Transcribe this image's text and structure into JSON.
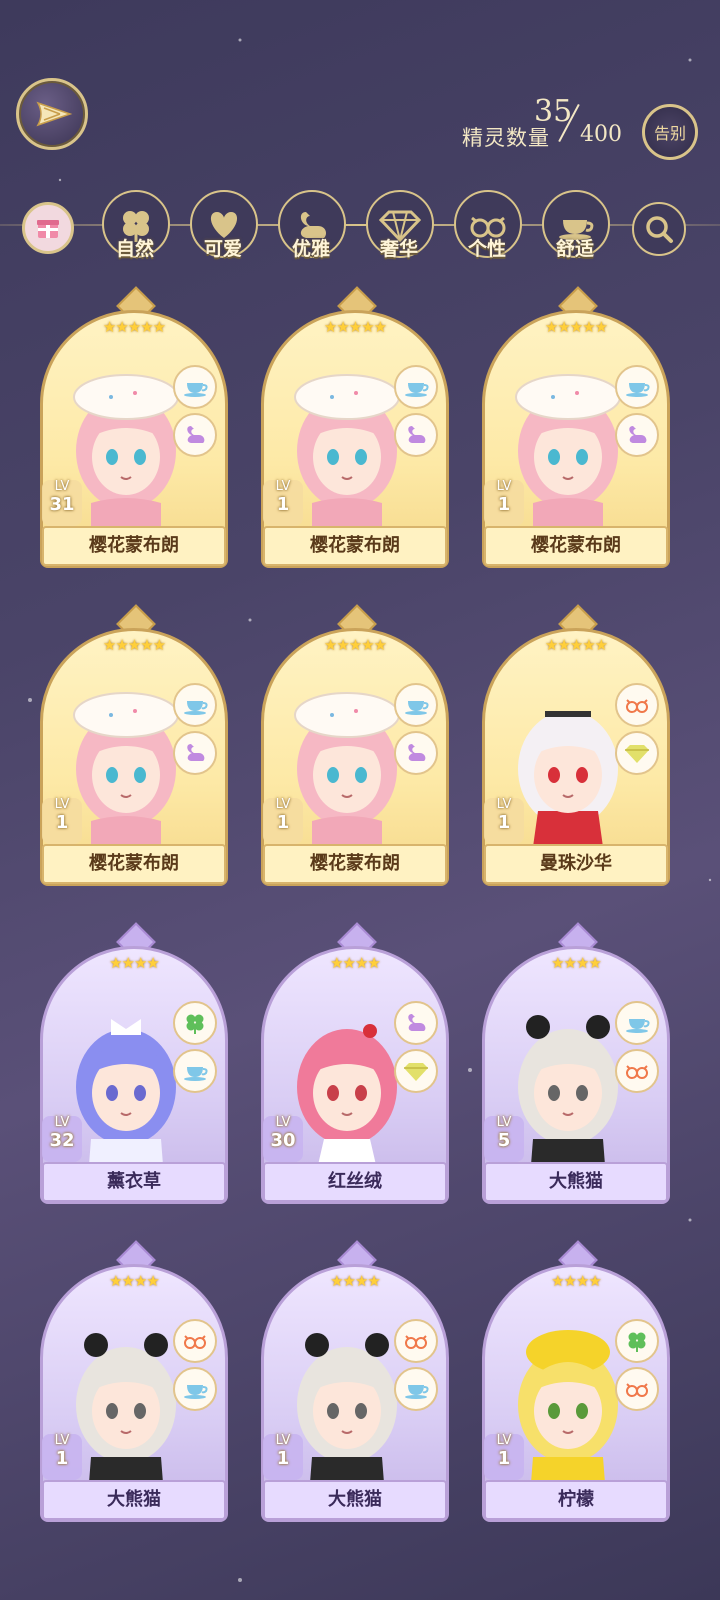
{
  "header": {
    "count_label": "精灵数量",
    "count_current": "35",
    "count_max": "400",
    "farewell_label": "告别"
  },
  "filters": [
    {
      "label": "自然",
      "icon": "clover-icon"
    },
    {
      "label": "可爱",
      "icon": "heart-icon"
    },
    {
      "label": "优雅",
      "icon": "swan-icon"
    },
    {
      "label": "奢华",
      "icon": "diamond-icon"
    },
    {
      "label": "个性",
      "icon": "glasses-icon"
    },
    {
      "label": "舒适",
      "icon": "teacup-icon"
    }
  ],
  "cards": [
    {
      "name": "樱花蒙布朗",
      "lv_label": "LV",
      "level": "31",
      "stars": 5,
      "frame": "gold",
      "badges": [
        "teacup-icon",
        "swan-icon"
      ]
    },
    {
      "name": "樱花蒙布朗",
      "lv_label": "LV",
      "level": "1",
      "stars": 5,
      "frame": "gold",
      "badges": [
        "teacup-icon",
        "swan-icon"
      ]
    },
    {
      "name": "樱花蒙布朗",
      "lv_label": "LV",
      "level": "1",
      "stars": 5,
      "frame": "gold",
      "badges": [
        "teacup-icon",
        "swan-icon"
      ]
    },
    {
      "name": "樱花蒙布朗",
      "lv_label": "LV",
      "level": "1",
      "stars": 5,
      "frame": "gold",
      "badges": [
        "teacup-icon",
        "swan-icon"
      ]
    },
    {
      "name": "樱花蒙布朗",
      "lv_label": "LV",
      "level": "1",
      "stars": 5,
      "frame": "gold",
      "badges": [
        "teacup-icon",
        "swan-icon"
      ]
    },
    {
      "name": "曼珠沙华",
      "lv_label": "LV",
      "level": "1",
      "stars": 5,
      "frame": "gold",
      "badges": [
        "glasses-icon",
        "diamond-icon"
      ]
    },
    {
      "name": "薰衣草",
      "lv_label": "LV",
      "level": "32",
      "stars": 4,
      "frame": "purple",
      "badges": [
        "clover-icon",
        "teacup-icon"
      ]
    },
    {
      "name": "红丝绒",
      "lv_label": "LV",
      "level": "30",
      "stars": 4,
      "frame": "purple",
      "badges": [
        "swan-icon",
        "diamond-icon"
      ]
    },
    {
      "name": "大熊猫",
      "lv_label": "LV",
      "level": "5",
      "stars": 4,
      "frame": "purple",
      "badges": [
        "teacup-icon",
        "glasses-icon"
      ]
    },
    {
      "name": "大熊猫",
      "lv_label": "LV",
      "level": "1",
      "stars": 4,
      "frame": "purple",
      "badges": [
        "glasses-icon",
        "teacup-icon"
      ]
    },
    {
      "name": "大熊猫",
      "lv_label": "LV",
      "level": "1",
      "stars": 4,
      "frame": "purple",
      "badges": [
        "glasses-icon",
        "teacup-icon"
      ]
    },
    {
      "name": "柠檬",
      "lv_label": "LV",
      "level": "1",
      "stars": 4,
      "frame": "purple",
      "badges": [
        "clover-icon",
        "glasses-icon"
      ]
    }
  ],
  "colors": {
    "gold_frame": "#caa35a",
    "purple_frame": "#b9a0d8",
    "label_text": "#fff5d8",
    "pink_accent": "#f08aa8",
    "star_color": "#ffcf3a"
  }
}
